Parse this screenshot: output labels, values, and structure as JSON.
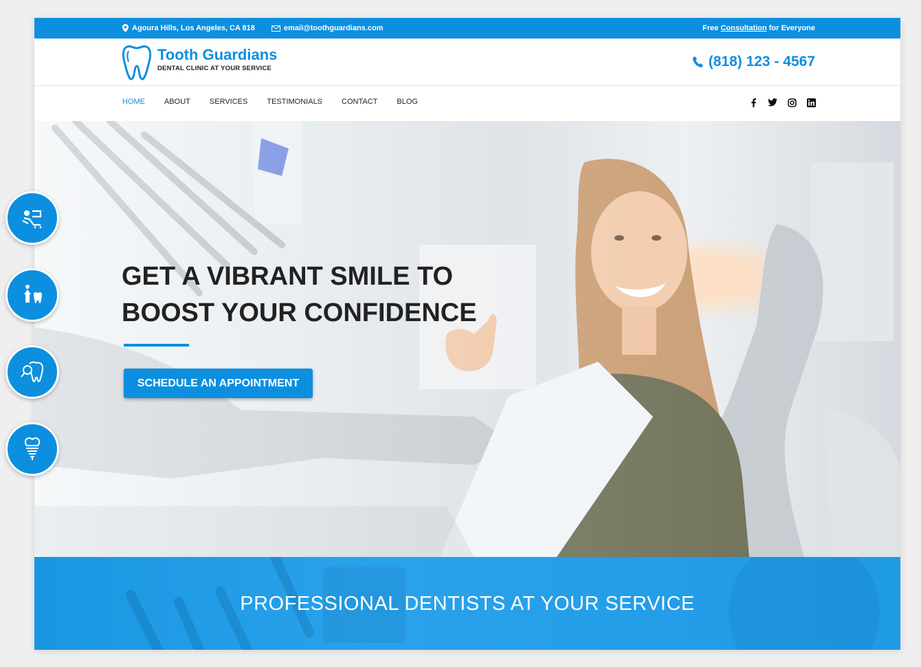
{
  "topbar": {
    "address": "Agoura Hills, Los Angeles, CA 818",
    "email": "email@toothguardians.com",
    "promo_prefix": "Free",
    "promo_link": "Consultation",
    "promo_suffix": "for Everyone"
  },
  "brand": {
    "name": "Tooth Guardians",
    "tagline": "DENTAL CLINIC AT YOUR SERVICE",
    "phone": "(818) 123 - 4567"
  },
  "nav": {
    "items": [
      {
        "label": "HOME",
        "active": true
      },
      {
        "label": "ABOUT"
      },
      {
        "label": "SERVICES"
      },
      {
        "label": "TESTIMONIALS"
      },
      {
        "label": "CONTACT"
      },
      {
        "label": "BLOG"
      }
    ]
  },
  "social": [
    "facebook-icon",
    "twitter-icon",
    "instagram-icon",
    "linkedin-icon"
  ],
  "hero": {
    "title_line1": "GET A VIBRANT SMILE TO",
    "title_line2": "BOOST YOUR CONFIDENCE",
    "cta_label": "SCHEDULE AN APPOINTMENT"
  },
  "band": {
    "title": "PROFESSIONAL DENTISTS AT YOUR SERVICE"
  },
  "side_services": [
    "dental-chair-icon",
    "family-tooth-icon",
    "tooth-care-icon",
    "dental-implant-icon"
  ],
  "colors": {
    "accent": "#0d8fdf",
    "band": "#2aa2eb",
    "text_dark": "#222222"
  }
}
